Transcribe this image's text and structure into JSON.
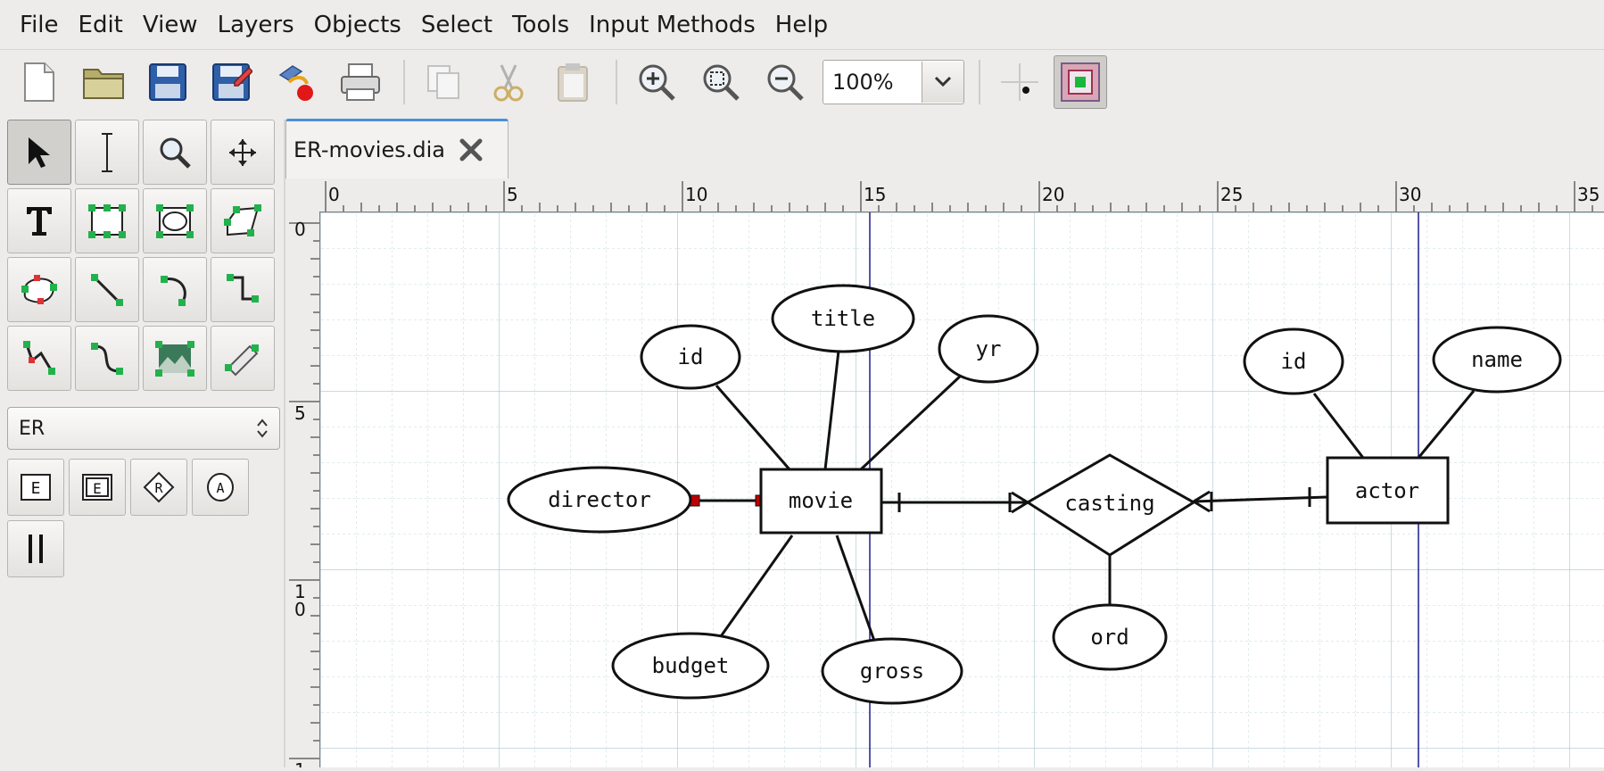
{
  "menubar": {
    "items": [
      "File",
      "Edit",
      "View",
      "Layers",
      "Objects",
      "Select",
      "Tools",
      "Input Methods",
      "Help"
    ]
  },
  "toolbar": {
    "buttons": [
      "new-file-icon",
      "open-folder-icon",
      "save-icon",
      "save-as-icon",
      "export-icon",
      "print-icon",
      "copy-icon",
      "cut-icon",
      "paste-icon",
      "zoom-in-icon",
      "zoom-fit-icon",
      "zoom-out-icon"
    ],
    "zoom_value": "100%"
  },
  "toolbox": {
    "tools": [
      "pointer",
      "text-edit",
      "magnify",
      "scroll",
      "text",
      "box",
      "ellipse",
      "polygon",
      "beziergon",
      "line",
      "arc",
      "zigzag-line",
      "polyline",
      "bezier-line",
      "image",
      "outline"
    ],
    "sheet": "ER",
    "sheet_tools": [
      "entity",
      "weak-entity",
      "relationship",
      "attribute",
      "participation"
    ]
  },
  "tab": {
    "title": "ER-movies.dia"
  },
  "ruler": {
    "h_labels": [
      "0",
      "5",
      "10",
      "15",
      "20",
      "25",
      "30",
      "35"
    ],
    "v_labels": [
      "0",
      "5",
      "1\n0",
      "1"
    ]
  },
  "diagram": {
    "entities": [
      "movie",
      "actor"
    ],
    "relationships": [
      "casting"
    ],
    "attributes": [
      "id",
      "title",
      "yr",
      "director",
      "budget",
      "gross",
      "ord",
      "id",
      "name"
    ]
  },
  "colors": {
    "grid": "#bfd4dc",
    "guide": "#1b1b8a",
    "connector": "#c00000",
    "tab_accent": "#4a90d9"
  }
}
